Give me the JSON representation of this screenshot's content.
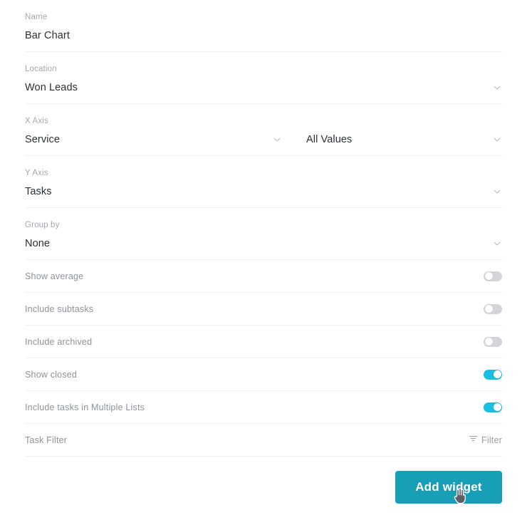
{
  "form": {
    "fields": [
      {
        "label": "Name",
        "value": "Bar Chart",
        "has_chevron": false
      },
      {
        "label": "Location",
        "value": "Won Leads",
        "has_chevron": true
      },
      {
        "label": "X Axis",
        "value": "Service",
        "value2": "All Values",
        "has_chevron": true
      },
      {
        "label": "Y Axis",
        "value": "Tasks",
        "has_chevron": true
      },
      {
        "label": "Group by",
        "value": "None",
        "has_chevron": true
      }
    ],
    "toggles": [
      {
        "label": "Show average",
        "state": "off"
      },
      {
        "label": "Include subtasks",
        "state": "off"
      },
      {
        "label": "Include archived",
        "state": "off"
      },
      {
        "label": "Show closed",
        "state": "on"
      },
      {
        "label": "Include tasks in Multiple Lists",
        "state": "on"
      }
    ],
    "task_filter": {
      "label": "Filter",
      "button_label": "Filter",
      "icon": "filter-icon"
    },
    "submit": {
      "label": "Add widget"
    }
  },
  "labels": {
    "name": "Name",
    "location": "Location",
    "x_axis": "X Axis",
    "y_axis": "Y Axis",
    "group_by": "Group by",
    "task_filter": "Task Filter"
  },
  "values": {
    "name": "Bar Chart",
    "location": "Won Leads",
    "x_axis": "Service",
    "x_axis_values": "All Values",
    "y_axis": "Tasks",
    "group_by": "None"
  },
  "colors": {
    "accent": "#189fb8",
    "toggle_on": "#18bfe0",
    "toggle_off": "#d3d5d8",
    "label_text": "#a4a9ae",
    "value_text": "#2b3034",
    "divider": "#f1f2f3"
  },
  "icons": {
    "chevron_down": "chevron-down-icon",
    "filter": "filter-icon",
    "cursor": "hand-pointer-cursor"
  }
}
